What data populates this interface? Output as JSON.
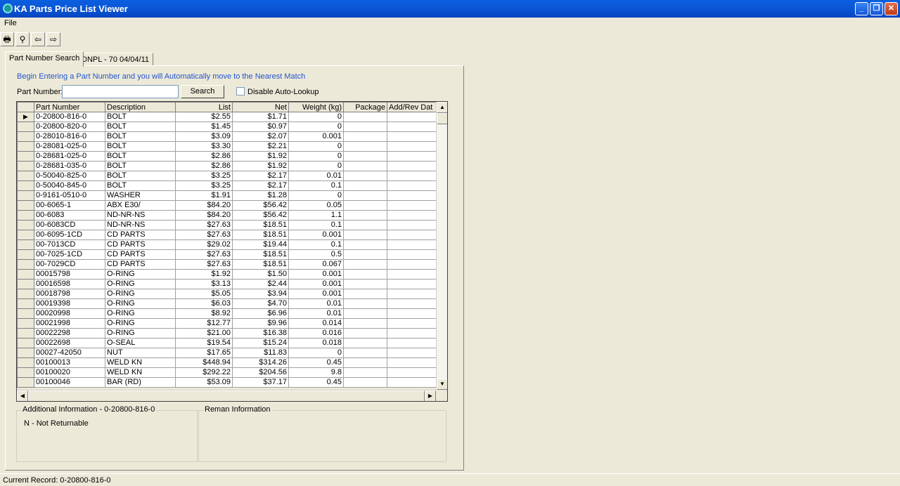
{
  "window": {
    "title": "KA Parts Price List Viewer"
  },
  "menu": {
    "file": "File"
  },
  "tabs": {
    "search": "Part Number Search",
    "list": "DNPL - 70  04/04/11"
  },
  "search": {
    "hint": "Begin Entering a Part Number and you will Automatically move to the Nearest Match",
    "label": "Part Number:",
    "value": "",
    "button": "Search",
    "disable_label": "Disable Auto-Lookup",
    "disable_checked": false
  },
  "grid": {
    "columns": [
      "Part Number",
      "Description",
      "List",
      "Net",
      "Weight (kg)",
      "Package",
      "Add/Rev Dat"
    ],
    "rows": [
      [
        "0-20800-816-0",
        "BOLT",
        "$2.55",
        "$1.71",
        "0",
        "",
        ""
      ],
      [
        "0-20800-820-0",
        "BOLT",
        "$1.45",
        "$0.97",
        "0",
        "",
        ""
      ],
      [
        "0-28010-816-0",
        "BOLT",
        "$3.09",
        "$2.07",
        "0.001",
        "",
        ""
      ],
      [
        "0-28081-025-0",
        "BOLT",
        "$3.30",
        "$2.21",
        "0",
        "",
        ""
      ],
      [
        "0-28681-025-0",
        "BOLT",
        "$2.86",
        "$1.92",
        "0",
        "",
        ""
      ],
      [
        "0-28681-035-0",
        "BOLT",
        "$2.86",
        "$1.92",
        "0",
        "",
        ""
      ],
      [
        "0-50040-825-0",
        "BOLT",
        "$3.25",
        "$2.17",
        "0.01",
        "",
        ""
      ],
      [
        "0-50040-845-0",
        "BOLT",
        "$3.25",
        "$2.17",
        "0.1",
        "",
        ""
      ],
      [
        "0-9161-0510-0",
        "WASHER",
        "$1.91",
        "$1.28",
        "0",
        "",
        ""
      ],
      [
        "00-6065-1",
        "ABX E30/",
        "$84.20",
        "$56.42",
        "0.05",
        "",
        ""
      ],
      [
        "00-6083",
        "ND-NR-NS",
        "$84.20",
        "$56.42",
        "1.1",
        "",
        ""
      ],
      [
        "00-6083CD",
        "ND-NR-NS",
        "$27.63",
        "$18.51",
        "0.1",
        "",
        ""
      ],
      [
        "00-6095-1CD",
        "CD PARTS",
        "$27.63",
        "$18.51",
        "0.001",
        "",
        ""
      ],
      [
        "00-7013CD",
        "CD PARTS",
        "$29.02",
        "$19.44",
        "0.1",
        "",
        ""
      ],
      [
        "00-7025-1CD",
        "CD PARTS",
        "$27.63",
        "$18.51",
        "0.5",
        "",
        ""
      ],
      [
        "00-7029CD",
        "CD PARTS",
        "$27.63",
        "$18.51",
        "0.067",
        "",
        ""
      ],
      [
        "00015798",
        "O-RING",
        "$1.92",
        "$1.50",
        "0.001",
        "",
        ""
      ],
      [
        "00016598",
        "O-RING",
        "$3.13",
        "$2.44",
        "0.001",
        "",
        ""
      ],
      [
        "00018798",
        "O-RING",
        "$5.05",
        "$3.94",
        "0.001",
        "",
        ""
      ],
      [
        "00019398",
        "O-RING",
        "$6.03",
        "$4.70",
        "0.01",
        "",
        ""
      ],
      [
        "00020998",
        "O-RING",
        "$8.92",
        "$6.96",
        "0.01",
        "",
        ""
      ],
      [
        "00021998",
        "O-RING",
        "$12.77",
        "$9.96",
        "0.014",
        "",
        ""
      ],
      [
        "00022298",
        "O-RING",
        "$21.00",
        "$16.38",
        "0.016",
        "",
        ""
      ],
      [
        "00022698",
        "O-SEAL",
        "$19.54",
        "$15.24",
        "0.018",
        "",
        ""
      ],
      [
        "00027-42050",
        "NUT",
        "$17.65",
        "$11.83",
        "0",
        "",
        ""
      ],
      [
        "00100013",
        "WELD  KN",
        "$448.94",
        "$314.26",
        "0.45",
        "",
        ""
      ],
      [
        "00100020",
        "WELD  KN",
        "$292.22",
        "$204.56",
        "9.8",
        "",
        ""
      ],
      [
        "00100046",
        "BAR (RD)",
        "$53.09",
        "$37.17",
        "0.45",
        "",
        ""
      ]
    ]
  },
  "additional": {
    "title": "Additional Information - 0-20800-816-0",
    "text": "N - Not Returnable"
  },
  "reman": {
    "title": "Reman Information"
  },
  "status": {
    "text": "Current Record: 0-20800-816-0"
  }
}
